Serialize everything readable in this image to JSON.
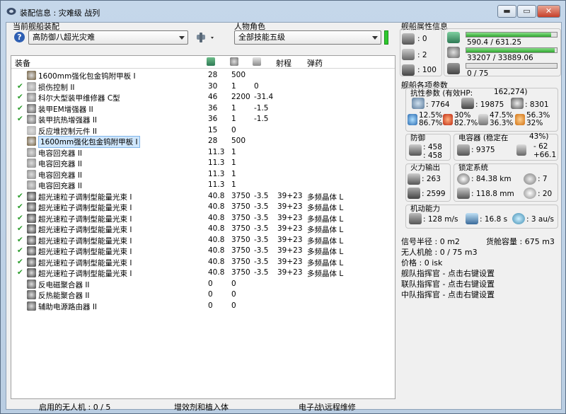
{
  "window": {
    "title": "装配信息 : 灾难级 战列",
    "minimize": "▬",
    "maximize": "▭",
    "close": "✕"
  },
  "fit": {
    "label": "当前舰船装配",
    "value": "高防御八超光灾难",
    "help": "?"
  },
  "character": {
    "label": "人物角色",
    "value": "全部技能五级"
  },
  "table": {
    "headers": [
      "装备",
      "",
      "",
      "",
      "射程",
      "弹药"
    ],
    "rows": [
      {
        "check": "",
        "name": "1600mm强化包金钨附甲板 I",
        "c1": "28",
        "c2": "500",
        "c3": "",
        "range": "",
        "ammo": ""
      },
      {
        "check": "✔",
        "name": "损伤控制 II",
        "c1": "30",
        "c2": "1",
        "c3": "0",
        "range": "",
        "ammo": ""
      },
      {
        "check": "✔",
        "name": "科尔大型装甲维修器 C型",
        "c1": "46",
        "c2": "2200",
        "c3": "-31.4",
        "range": "",
        "ammo": ""
      },
      {
        "check": "✔",
        "name": "装甲EM增强器 II",
        "c1": "36",
        "c2": "1",
        "c3": "-1.5",
        "range": "",
        "ammo": ""
      },
      {
        "check": "✔",
        "name": "装甲抗热增强器 II",
        "c1": "36",
        "c2": "1",
        "c3": "-1.5",
        "range": "",
        "ammo": ""
      },
      {
        "check": "",
        "name": "反应堆控制元件 II",
        "c1": "15",
        "c2": "0",
        "c3": "",
        "range": "",
        "ammo": ""
      },
      {
        "check": "",
        "name": "1600mm强化包金钨附甲板 I",
        "c1": "28",
        "c2": "500",
        "c3": "",
        "range": "",
        "ammo": "",
        "selected": true
      },
      {
        "check": "",
        "name": "电容回充器 II",
        "c1": "11.3",
        "c2": "1",
        "c3": "",
        "range": "",
        "ammo": ""
      },
      {
        "check": "",
        "name": "电容回充器 II",
        "c1": "11.3",
        "c2": "1",
        "c3": "",
        "range": "",
        "ammo": ""
      },
      {
        "check": "",
        "name": "电容回充器 II",
        "c1": "11.3",
        "c2": "1",
        "c3": "",
        "range": "",
        "ammo": ""
      },
      {
        "check": "",
        "name": "电容回充器 II",
        "c1": "11.3",
        "c2": "1",
        "c3": "",
        "range": "",
        "ammo": ""
      },
      {
        "check": "✔",
        "name": "超光速粒子调制型能量光束 I",
        "c1": "40.8",
        "c2": "3750",
        "c3": "-3.5",
        "range": "39+23",
        "ammo": "多频晶体 L"
      },
      {
        "check": "✔",
        "name": "超光速粒子调制型能量光束 I",
        "c1": "40.8",
        "c2": "3750",
        "c3": "-3.5",
        "range": "39+23",
        "ammo": "多频晶体 L"
      },
      {
        "check": "✔",
        "name": "超光速粒子调制型能量光束 I",
        "c1": "40.8",
        "c2": "3750",
        "c3": "-3.5",
        "range": "39+23",
        "ammo": "多频晶体 L"
      },
      {
        "check": "✔",
        "name": "超光速粒子调制型能量光束 I",
        "c1": "40.8",
        "c2": "3750",
        "c3": "-3.5",
        "range": "39+23",
        "ammo": "多频晶体 L"
      },
      {
        "check": "✔",
        "name": "超光速粒子调制型能量光束 I",
        "c1": "40.8",
        "c2": "3750",
        "c3": "-3.5",
        "range": "39+23",
        "ammo": "多频晶体 L"
      },
      {
        "check": "✔",
        "name": "超光速粒子调制型能量光束 I",
        "c1": "40.8",
        "c2": "3750",
        "c3": "-3.5",
        "range": "39+23",
        "ammo": "多频晶体 L"
      },
      {
        "check": "✔",
        "name": "超光速粒子调制型能量光束 I",
        "c1": "40.8",
        "c2": "3750",
        "c3": "-3.5",
        "range": "39+23",
        "ammo": "多频晶体 L"
      },
      {
        "check": "✔",
        "name": "超光速粒子调制型能量光束 I",
        "c1": "40.8",
        "c2": "3750",
        "c3": "-3.5",
        "range": "39+23",
        "ammo": "多频晶体 L"
      },
      {
        "check": "",
        "name": "反电磁聚合器 II",
        "c1": "0",
        "c2": "0",
        "c3": "",
        "range": "",
        "ammo": ""
      },
      {
        "check": "",
        "name": "反热能聚合器 II",
        "c1": "0",
        "c2": "0",
        "c3": "",
        "range": "",
        "ammo": ""
      },
      {
        "check": "",
        "name": "辅助电源路由器 II",
        "c1": "0",
        "c2": "0",
        "c3": "",
        "range": "",
        "ammo": ""
      }
    ]
  },
  "bottom": {
    "drones": "启用的无人机 : 0 / 5",
    "implants": "增效剂和植入体",
    "ewar": "电子战\\远程维修"
  },
  "ship": {
    "title": "舰船属性信息",
    "slots": {
      "high": "0",
      "med": "2",
      "low": "100"
    },
    "cpu": {
      "text": "590.4 / 631.25",
      "pct": 0.935
    },
    "power": {
      "text": "33207 / 33889.06",
      "pct": 0.98
    },
    "calib": {
      "text": "0 / 75",
      "pct": 0
    }
  },
  "params": {
    "title": "舰船各项参数",
    "res_title": "抗性参数 (有效HP:",
    "ehp": "162,274)",
    "shield_hp": ": 7764",
    "armor_hp": ": 19875",
    "hull_hp": ": 8301",
    "res1a": "12.5%",
    "res1b": "86.7%",
    "res2a": "30%",
    "res2b": "82.7%",
    "res3a": "47.5%",
    "res3b": "36.3%",
    "res4a": "56.3%",
    "res4b": "32%"
  },
  "defense": {
    "title": "防御",
    "v1": ": 458",
    "v2": ": 458"
  },
  "cap": {
    "title": "电容器 (稳定在",
    "stable": "43%)",
    "amount": ": 9375",
    "delta1": "- 62",
    "delta2": "+66.1"
  },
  "fire": {
    "title": "火力输出",
    "dps": ": 263",
    "volley": ": 2599"
  },
  "target": {
    "title": "锁定系统",
    "range": ": 84.38 km",
    "num": ": 7",
    "scan": ": 118.8 mm",
    "sensor": ": 20"
  },
  "mobility": {
    "title": "机动能力",
    "speed": ": 128 m/s",
    "align": ": 16.8 s",
    "warp": ": 3 au/s"
  },
  "misc": {
    "sig": "信号半径 : 0 m2",
    "cargo": "货舱容量 : 675 m3",
    "drone": "无人机舱 : 0 / 75 m3",
    "price": "价格 : 0 isk",
    "boost1": "舰队指挥官 - 点击右键设置",
    "boost2": "联队指挥官 - 点击右键设置",
    "boost3": "中队指挥官 - 点击右键设置"
  }
}
